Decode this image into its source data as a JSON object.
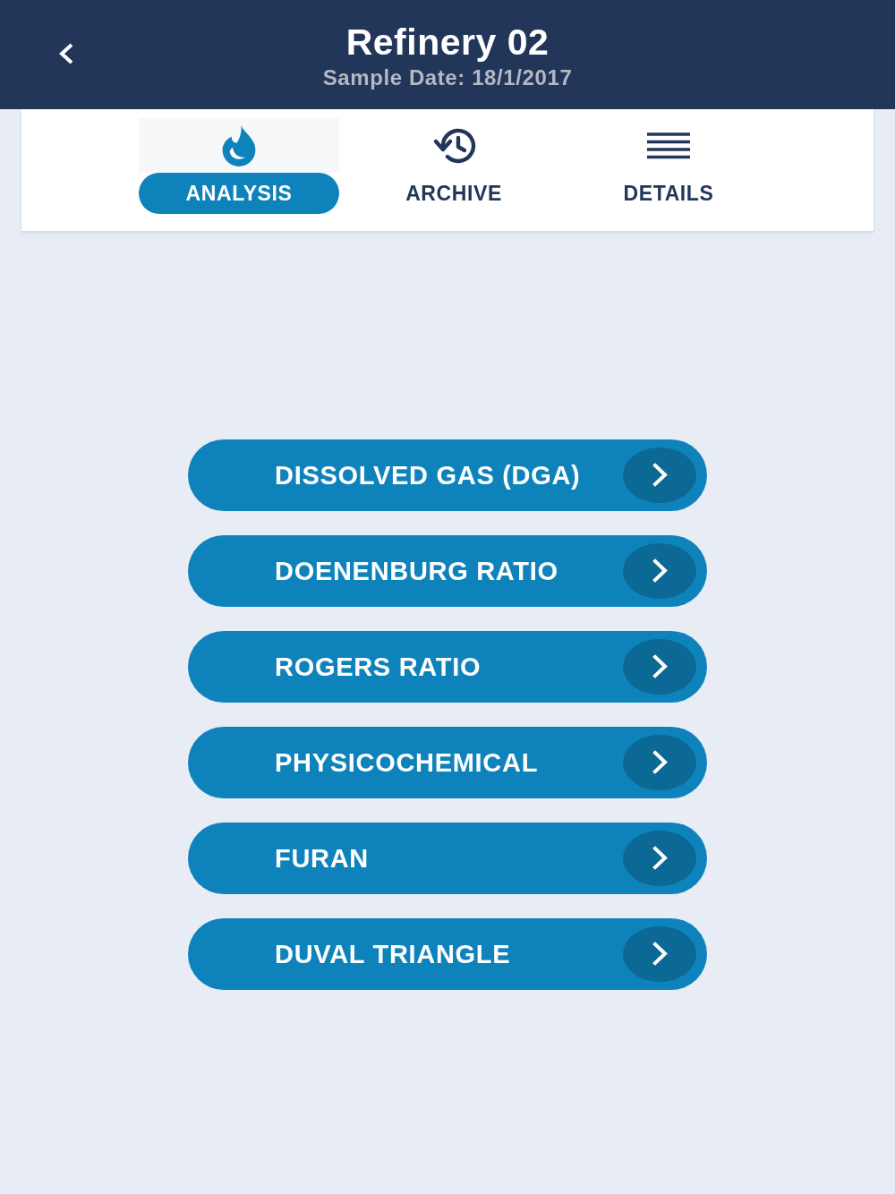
{
  "header": {
    "title": "Refinery 02",
    "subtitle": "Sample Date: 18/1/2017"
  },
  "tabs": [
    {
      "label": "ANALYSIS",
      "selected": true
    },
    {
      "label": "ARCHIVE",
      "selected": false
    },
    {
      "label": "DETAILS",
      "selected": false
    }
  ],
  "menu": [
    {
      "label": "DISSOLVED GAS (DGA)"
    },
    {
      "label": "DOENENBURG RATIO"
    },
    {
      "label": "ROGERS RATIO"
    },
    {
      "label": "PHYSICOCHEMICAL"
    },
    {
      "label": "FURAN"
    },
    {
      "label": "DUVAL TRIANGLE"
    }
  ]
}
